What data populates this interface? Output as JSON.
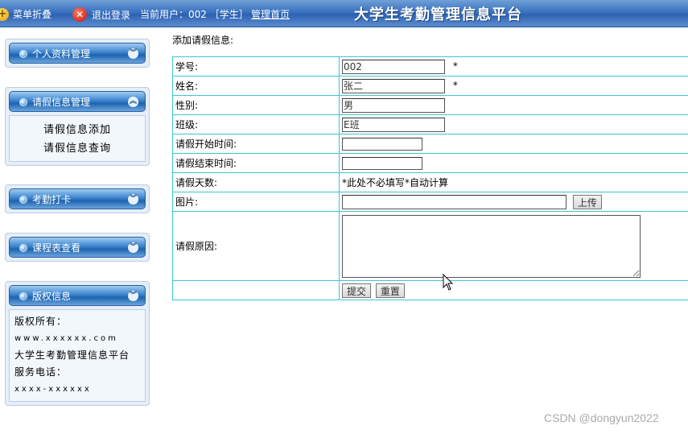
{
  "topbar": {
    "fold_label": "菜单折叠",
    "logout_label": "退出登录",
    "current_user": "当前用户：002 ［学生］",
    "home_label": "管理首页",
    "title": "大学生考勤管理信息平台"
  },
  "sidebar": {
    "panels": [
      {
        "label": "个人资料管理",
        "expanded": false
      },
      {
        "label": "请假信息管理",
        "expanded": true,
        "items": [
          "请假信息添加",
          "请假信息查询"
        ]
      },
      {
        "label": "考勤打卡",
        "expanded": false
      },
      {
        "label": "课程表查看",
        "expanded": false
      },
      {
        "label": "版权信息",
        "expanded": true,
        "lines": [
          "版权所有：",
          "www.xxxxxx.com",
          "大学生考勤管理信息平台",
          "服务电话：",
          "xxxx-xxxxxx"
        ]
      }
    ]
  },
  "form": {
    "title": "添加请假信息:",
    "fields": {
      "student_id": {
        "label": "学号:",
        "value": "002"
      },
      "name": {
        "label": "姓名:",
        "value": "张二"
      },
      "gender": {
        "label": "性别:",
        "value": "男"
      },
      "class": {
        "label": "班级:",
        "value": "E班"
      },
      "start_time": {
        "label": "请假开始时间:",
        "value": ""
      },
      "end_time": {
        "label": "请假结束时间:",
        "value": ""
      },
      "days": {
        "label": "请假天数:",
        "note": "*此处不必填写*自动计算"
      },
      "image": {
        "label": "图片:",
        "value": "",
        "upload_label": "上传"
      },
      "reason": {
        "label": "请假原因:",
        "value": ""
      }
    },
    "required_mark": "*",
    "submit_label": "提交",
    "reset_label": "重置"
  },
  "watermark": "CSDN @dongyun2022",
  "colors": {
    "topbar": "#3a72c0",
    "table_border": "#39c6d6",
    "panel_bg": "#e6eef7"
  }
}
